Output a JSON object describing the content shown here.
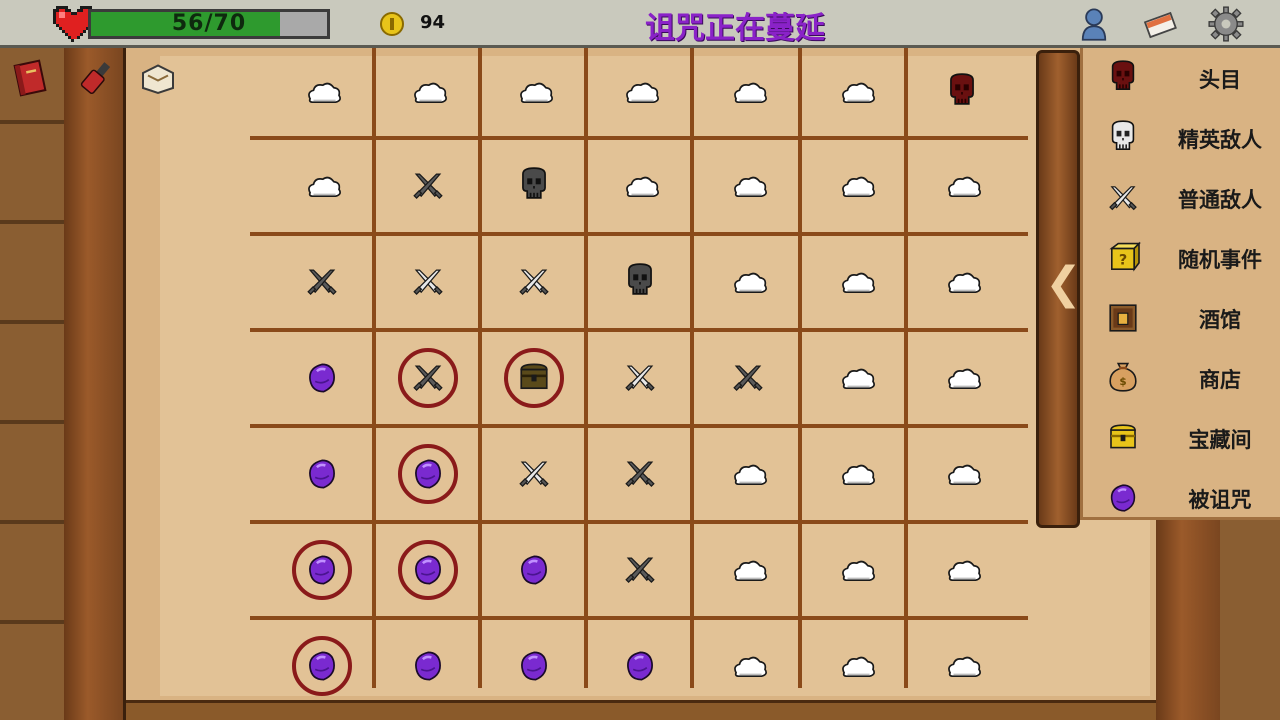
{
  "hud": {
    "hp_text": "56/70",
    "hp_fraction": 0.8,
    "gold": "94",
    "title": "诅咒正在蔓延"
  },
  "icons": {
    "top_right": [
      "profile-icon",
      "card-icon",
      "gear-icon"
    ],
    "left_column": [
      "book-icon",
      "potion-icon",
      "map-scroll-icon"
    ]
  },
  "legend": [
    {
      "key": "boss",
      "label": "头目",
      "icon": "red-skull-icon"
    },
    {
      "key": "elite",
      "label": "精英敌人",
      "icon": "white-skull-icon"
    },
    {
      "key": "enemy",
      "label": "普通敌人",
      "icon": "crossed-swords-icon"
    },
    {
      "key": "event",
      "label": "随机事件",
      "icon": "mystery-box-icon"
    },
    {
      "key": "tavern",
      "label": "酒馆",
      "icon": "tavern-icon"
    },
    {
      "key": "shop",
      "label": "商店",
      "icon": "money-bag-icon"
    },
    {
      "key": "treasure",
      "label": "宝藏间",
      "icon": "treasure-chest-icon"
    },
    {
      "key": "cursed",
      "label": "被诅咒",
      "icon": "purple-orb-icon"
    }
  ],
  "map": {
    "rows": [
      [
        "cloud",
        "cloud",
        "cloud",
        "cloud",
        "cloud",
        "cloud",
        "boss"
      ],
      [
        "cloud",
        "enemy_dark",
        "elite_dark",
        "cloud",
        "cloud",
        "cloud",
        "cloud"
      ],
      [
        "enemy_dark",
        "enemy",
        "enemy",
        "elite_dark",
        "cloud",
        "cloud",
        "cloud"
      ],
      [
        "cursed",
        "enemy_dark",
        "treasure_dark",
        "enemy",
        "enemy_dark",
        "cloud",
        "cloud"
      ],
      [
        "cursed",
        "cursed",
        "enemy",
        "enemy_dark",
        "cloud",
        "cloud",
        "cloud"
      ],
      [
        "cursed",
        "cursed",
        "cursed",
        "enemy_dark",
        "cloud",
        "cloud",
        "cloud"
      ],
      [
        "cursed",
        "cursed",
        "cursed",
        "cursed",
        "cloud",
        "cloud",
        "cloud"
      ]
    ],
    "circled": [
      [
        3,
        1
      ],
      [
        3,
        2
      ],
      [
        4,
        1
      ],
      [
        5,
        0
      ],
      [
        5,
        1
      ],
      [
        6,
        0
      ]
    ]
  },
  "colors": {
    "title": "#8a22c8",
    "hp_green": "#2e9a2e",
    "grid_line": "#8a4a1a",
    "circle": "#8a1a1a",
    "cursed": "#7a2ad0"
  }
}
